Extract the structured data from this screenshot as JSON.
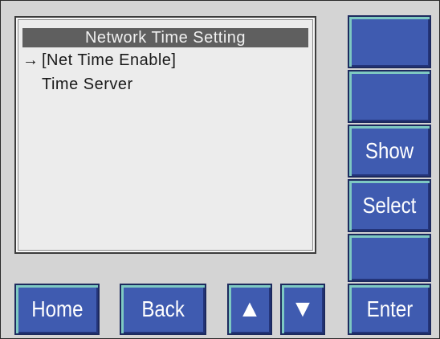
{
  "screen": {
    "title": "Network Time Setting",
    "items": [
      {
        "pointer": "→",
        "label": "[Net Time Enable]"
      },
      {
        "pointer": "",
        "label": "Time Server"
      }
    ]
  },
  "side_buttons": [
    "",
    "",
    "Show",
    "Select",
    "",
    "Enter"
  ],
  "bottom_buttons": {
    "home": "Home",
    "back": "Back",
    "up_icon": "▲",
    "down_icon": "▼"
  },
  "colors": {
    "button_fill": "#3f5bb0",
    "button_highlight": "#7ec9c2",
    "screen_bg": "#ececec",
    "title_bar": "#5f5f5f",
    "panel_bg": "#d4d4d4"
  }
}
